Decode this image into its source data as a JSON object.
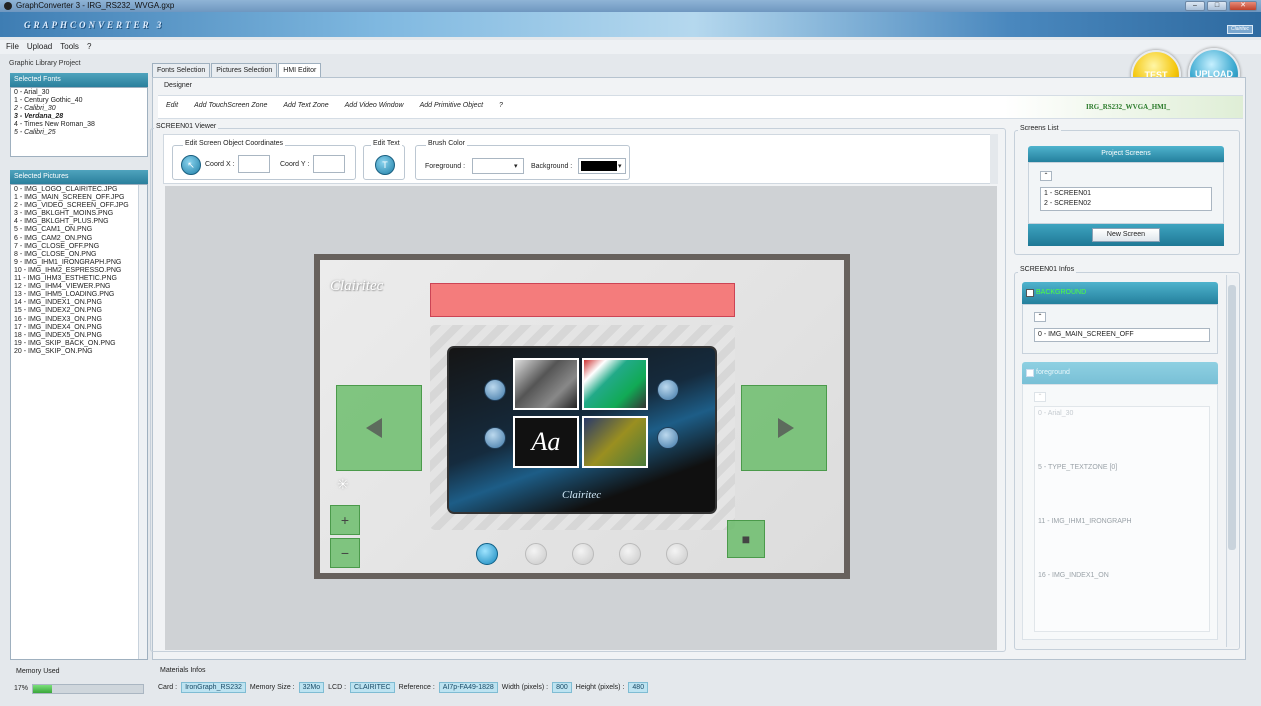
{
  "window": {
    "title": "GraphConverter 3 - IRG_RS232_WVGA.gxp",
    "brand": "GRAPHCONVERTER 3",
    "brand_right": "Clairitec"
  },
  "menu": [
    "File",
    "Upload",
    "Tools",
    "?"
  ],
  "left": {
    "project_label": "Graphic Library Project",
    "fonts_title": "Selected Fonts",
    "fonts": [
      "0 - Arial_30",
      "1 - Century Gothic_40",
      "2 - Calibri_30",
      "3 - Verdana_28",
      "4 - Times New Roman_38",
      "5 - Calibri_25"
    ],
    "pictures_title": "Selected Pictures",
    "pictures": [
      "0 - IMG_LOGO_CLAIRITEC.JPG",
      "1 - IMG_MAIN_SCREEN_OFF.JPG",
      "2 - IMG_VIDEO_SCREEN_OFF.JPG",
      "3 - IMG_BKLGHT_MOINS.PNG",
      "4 - IMG_BKLGHT_PLUS.PNG",
      "5 - IMG_CAM1_ON.PNG",
      "6 - IMG_CAM2_ON.PNG",
      "7 - IMG_CLOSE_OFF.PNG",
      "8 - IMG_CLOSE_ON.PNG",
      "9 - IMG_IHM1_IRONGRAPH.PNG",
      "10 - IMG_IHM2_ESPRESSO.PNG",
      "11 - IMG_IHM3_ESTHETIC.PNG",
      "12 - IMG_IHM4_VIEWER.PNG",
      "13 - IMG_IHM5_LOADING.PNG",
      "14 - IMG_INDEX1_ON.PNG",
      "15 - IMG_INDEX2_ON.PNG",
      "16 - IMG_INDEX3_ON.PNG",
      "17 - IMG_INDEX4_ON.PNG",
      "18 - IMG_INDEX5_ON.PNG",
      "19 - IMG_SKIP_BACK_ON.PNG",
      "20 - IMG_SKIP_ON.PNG"
    ]
  },
  "tabs": [
    "Fonts Selection",
    "Pictures Selection",
    "HMI Editor"
  ],
  "designer": {
    "label": "Designer",
    "menu": [
      "Edit",
      "Add TouchScreen Zone",
      "Add Text Zone",
      "Add Video Window",
      "Add Primitive Object",
      "?"
    ],
    "project_name": "IRG_RS232_WVGA_HMI_"
  },
  "viewer": {
    "label": "SCREEN01 Viewer",
    "coords_label": "Edit Screen Object Coordinates",
    "coord_x_label": "Coord X :",
    "coord_y_label": "Coord Y :",
    "edit_text_label": "Edit Text",
    "brush_label": "Brush Color",
    "foreground_label": "Foreground :",
    "background_label": "Background :"
  },
  "hmi": {
    "logo": "Clairitec",
    "tile_text": "Aa",
    "screen_logo": "Clairitec"
  },
  "screens": {
    "label": "Screens List",
    "header": "Project Screens",
    "items": [
      "1 - SCREEN01",
      "2 - SCREEN02"
    ],
    "new_button": "New Screen"
  },
  "infos": {
    "label": "SCREEN01 Infos",
    "background_title": "BACKGROUND",
    "background_value": "0 - IMG_MAIN_SCREEN_OFF",
    "foreground_title": "foreground",
    "foreground_items": [
      "0 - Arial_30",
      "5 - TYPE_TEXTZONE [0]",
      "11 - IMG_IHM1_IRONGRAPH",
      "16 - IMG_INDEX1_ON"
    ]
  },
  "status": {
    "memory_label": "Memory Used",
    "memory_percent": "17%",
    "memory_fraction": 0.17,
    "materials_label": "Materials Infos",
    "fields": [
      {
        "label": "Card :",
        "value": "IronGraph_RS232"
      },
      {
        "label": "Memory Size :",
        "value": "32Mo"
      },
      {
        "label": "LCD :",
        "value": "CLAIRITEC"
      },
      {
        "label": "Reference :",
        "value": "AI7p-FA49-1828"
      },
      {
        "label": "Width (pixels) :",
        "value": "800"
      },
      {
        "label": "Height (pixels) :",
        "value": "480"
      }
    ]
  },
  "actions": {
    "test": "TEST",
    "upload": "UPLOAD"
  },
  "colors": {
    "accent": "#2a7f9c",
    "test": "#f4c60c",
    "upload": "#3aa8cf",
    "textzone": "#f47c7c",
    "touchzone": "#5cb85c"
  }
}
